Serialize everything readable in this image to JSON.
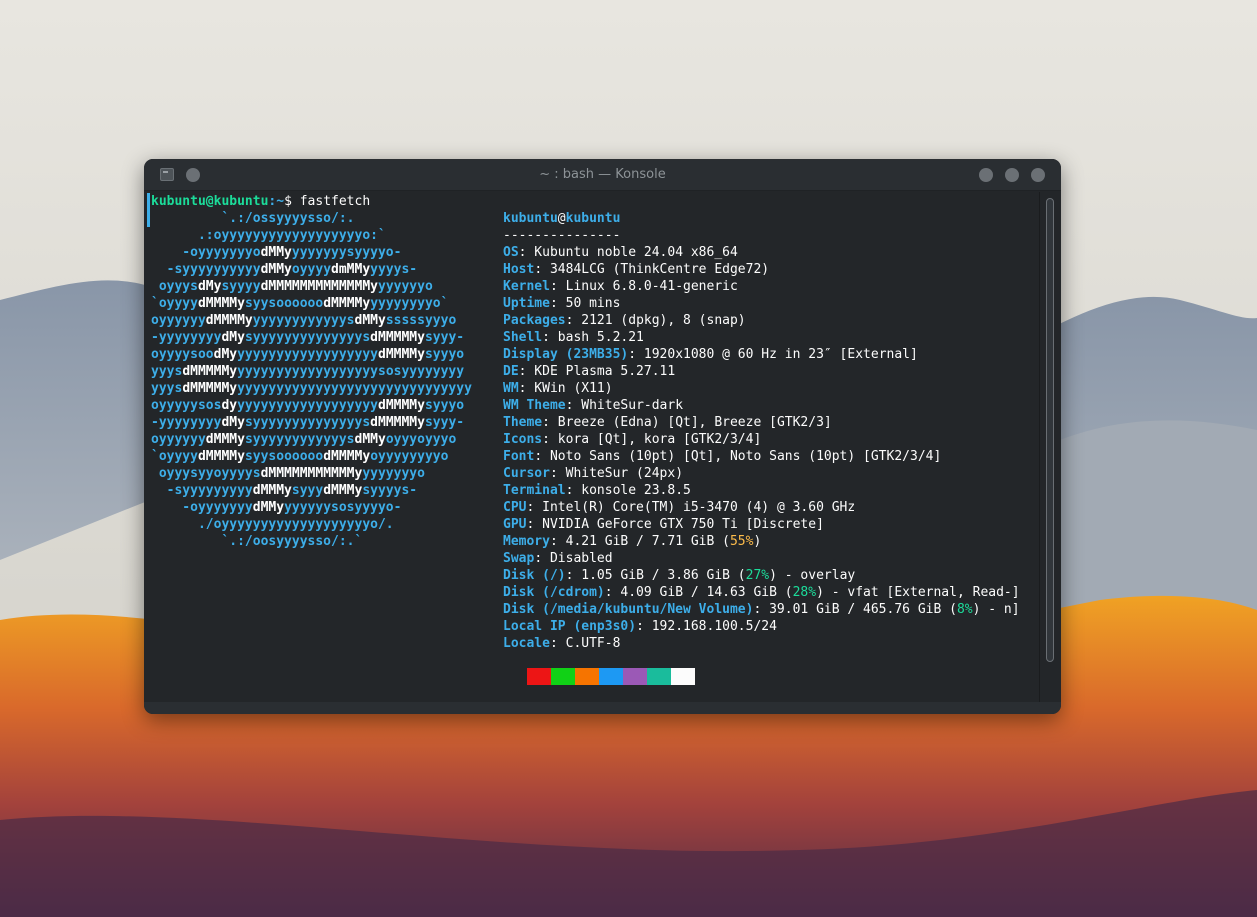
{
  "window": {
    "title": "~ : bash — Konsole"
  },
  "prompt": {
    "user_host": "kubuntu@kubuntu",
    "path": ":~",
    "symbol": "$ ",
    "command": "fastfetch"
  },
  "logo_lines": [
    "         `.:/ossyyyysso/:.",
    "      .:oyyyyyyyyyyyyyyyyyyo:`",
    "    -oyyyyyyyo<b>dMMy</b>yyyyyyysyyyyo-",
    "  -syyyyyyyyyy<b>dMMy</b>oyyyy<b>dmMMy</b>yyyys-",
    " oyyys<b>dMy</b>syyyy<b>dMMMMMMMMMMMMMy</b>yyyyyyo",
    "`oyyyy<b>dMMMMy</b>syysoooooo<b>dMMMMy</b>yyyyyyyyo`",
    "oyyyyyy<b>dMMMMy</b>yyyyyyyyyyyys<b>dMMy</b>sssssyyyo",
    "-yyyyyyyy<b>dMy</b>syyyyyyyyyyyyyys<b>dMMMMMy</b>syyy-",
    "oyyyysoo<b>dMy</b>yyyyyyyyyyyyyyyyyy<b>dMMMMy</b>syyyo",
    "yyys<b>dMMMMMy</b>yyyyyyyyyyyyyyyyyysosyyyyyyyy",
    "yyys<b>dMMMMMy</b>yyyyyyyyyyyyyyyyyyyyyyyyyyyyyy",
    "oyyyyysos<b>dy</b>yyyyyyyyyyyyyyyyyy<b>dMMMMy</b>syyyo",
    "-yyyyyyyy<b>dMy</b>syyyyyyyyyyyyyys<b>dMMMMMy</b>syyy-",
    "oyyyyyy<b>dMMMy</b>syyyyyyyyyyyys<b>dMMy</b>oyyyoyyyo",
    "`oyyyy<b>dMMMMy</b>syysoooooo<b>dMMMMy</b>oyyyyyyyyo",
    " oyyysyyoyyyys<b>dMMMMMMMMMMMy</b>yyyyyyyo",
    "  -syyyyyyyyy<b>dMMMy</b>syyy<b>dMMMy</b>syyyys-",
    "    -oyyyyyyy<b>dMMy</b>yyyyyysosyyyyo-",
    "      ./oyyyyyyyyyyyyyyyyyyyo/.",
    "         `.:/oosyyyysso/:.`"
  ],
  "info": {
    "header_user": "kubuntu",
    "header_at": "@",
    "header_host": "kubuntu",
    "separator": "---------------",
    "rows": [
      {
        "key": "OS",
        "value": ": Kubuntu noble 24.04 x86_64"
      },
      {
        "key": "Host",
        "value": ": 3484LCG (ThinkCentre Edge72)"
      },
      {
        "key": "Kernel",
        "value": ": Linux 6.8.0-41-generic"
      },
      {
        "key": "Uptime",
        "value": ": 50 mins"
      },
      {
        "key": "Packages",
        "value": ": 2121 (dpkg), 8 (snap)"
      },
      {
        "key": "Shell",
        "value": ": bash 5.2.21"
      },
      {
        "key": "Display (23MB35)",
        "value": ": 1920x1080 @ 60 Hz in 23″ [External]"
      },
      {
        "key": "DE",
        "value": ": KDE Plasma 5.27.11"
      },
      {
        "key": "WM",
        "value": ": KWin (X11)"
      },
      {
        "key": "WM Theme",
        "value": ": WhiteSur-dark"
      },
      {
        "key": "Theme",
        "value": ": Breeze (Edna) [Qt], Breeze [GTK2/3]"
      },
      {
        "key": "Icons",
        "value": ": kora [Qt], kora [GTK2/3/4]"
      },
      {
        "key": "Font",
        "value": ": Noto Sans (10pt) [Qt], Noto Sans (10pt) [GTK2/3/4]"
      },
      {
        "key": "Cursor",
        "value": ": WhiteSur (24px)"
      },
      {
        "key": "Terminal",
        "value": ": konsole 23.8.5"
      },
      {
        "key": "CPU",
        "value": ": Intel(R) Core(TM) i5-3470 (4) @ 3.60 GHz"
      },
      {
        "key": "GPU",
        "value": ": NVIDIA GeForce GTX 750 Ti [Discrete]"
      }
    ],
    "memory": {
      "key": "Memory",
      "pre": ": 4.21 GiB / 7.71 GiB (",
      "pct": "55%",
      "post": ")"
    },
    "swap": {
      "key": "Swap",
      "value": ": Disabled"
    },
    "disks": [
      {
        "key": "Disk (/)",
        "pre": ": 1.05 GiB / 3.86 GiB (",
        "pct": "27%",
        "post": ") - overlay"
      },
      {
        "key": "Disk (/cdrom)",
        "pre": ": 4.09 GiB / 14.63 GiB (",
        "pct": "28%",
        "post": ") - vfat [External, Read-]"
      },
      {
        "key": "Disk (/media/kubuntu/New Volume)",
        "pre": ": 39.01 GiB / 465.76 GiB (",
        "pct": "8%",
        "post": ") - n]"
      }
    ],
    "local_ip": {
      "key": "Local IP (enp3s0)",
      "value": ": 192.168.100.5/24"
    },
    "locale": {
      "key": "Locale",
      "value": ": C.UTF-8"
    }
  },
  "colors": {
    "palette": [
      "#ed1515",
      "#11d116",
      "#f67400",
      "#1d99f3",
      "#9b59b6",
      "#1abc9c",
      "#fcfcfc"
    ],
    "accent": "#3daee9",
    "green": "#1cdc9a",
    "yellow": "#fdbc4b",
    "background": "#232629"
  },
  "icons": {
    "app": "konsole-icon",
    "pin": "keep-above-icon",
    "minimize": "minimize-icon",
    "maximize": "maximize-icon",
    "close": "close-icon"
  }
}
